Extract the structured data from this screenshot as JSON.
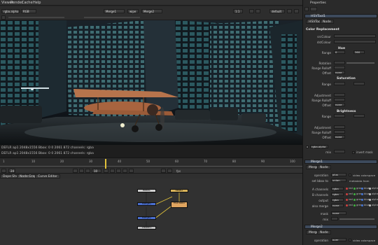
{
  "menu": {
    "items": [
      "Viewer",
      "Render",
      "Cache",
      "Help"
    ]
  },
  "viewer_toolbar": {
    "channels_value": "rgba.alpha",
    "color_value": "RGB",
    "input_a": "Merge1",
    "ab_mode": "wipe",
    "input_b": "Merge2",
    "zoom_value": "1:1",
    "lut_value": "default"
  },
  "viewer_status": {
    "line1": "DEFLR ap1 2048x1556 Bbox: 0 0 2061 872 channels: rgba",
    "line2": "DEFLR ap1 2048x1556 Bbox: 0 0 2061 872 channels: rgba"
  },
  "timeline": {
    "ticks": [
      "1",
      "10",
      "20",
      "30",
      "40",
      "50",
      "60",
      "70",
      "80",
      "90",
      "100"
    ],
    "fps_label": "fps",
    "fps_value": "24",
    "frame_value": "10"
  },
  "node_tabs": [
    "Dope Sheet",
    "Node Graph",
    "Curve Editor"
  ],
  "nodes": {
    "read1": "Read1",
    "merge1": "Merge1",
    "grade1": "Grade1",
    "merge2": "Merge2",
    "viewer": "Viewer1",
    "hsvtool": "HSVTool1",
    "read2": "Read2"
  },
  "properties": {
    "title": "Properties",
    "panel1": {
      "name": "HSVTool1",
      "tabs": [
        "HSVTool",
        "Node"
      ],
      "section_color_replacement": "Color Replacement",
      "src_colour": "srcColour",
      "dst_colour": "dstColour",
      "hue_section": "Hue",
      "range": "Range",
      "range_value": "0",
      "range_value2": "360",
      "rotation": "Rotation",
      "range_rolloff": "Range Rolloff",
      "offset": "Offset",
      "saturation_section": "Saturation",
      "adjustment": "Adjustment",
      "brightness_section": "Brightness",
      "none": "none",
      "mask_value": "rgba.alpha",
      "invert_mask": "invert mask",
      "mix": "mix"
    },
    "panel2": {
      "name": "Merge1",
      "tabs": [
        "Merge",
        "Node"
      ],
      "operation_label": "operation",
      "operation_value": "plus",
      "video_colorspace": "video colorspace",
      "set_bbox_label": "set bbox to",
      "set_bbox_value": "union",
      "metadata_from": "metadata from",
      "a_channels": "A channels",
      "b_channels": "B channels",
      "output": "output",
      "also_merge": "also merge",
      "rgba": "rgba",
      "none": "none",
      "channel_flags": [
        "red",
        "green",
        "blue",
        "alpha"
      ],
      "mask_label": "mask",
      "mix_label": "mix"
    },
    "panel3": {
      "name": "Merge2",
      "tabs": [
        "Merge",
        "Node"
      ],
      "operation_label": "operation",
      "operation_value": "over",
      "video_colorspace": "video colorspace"
    }
  },
  "colors": {
    "accent": "#e1c23a",
    "node_blue": "#4a6fd0",
    "node_merge": "#b8b8b8",
    "node_read": "#d9b35a",
    "panel_header": "#3d4a5c"
  }
}
